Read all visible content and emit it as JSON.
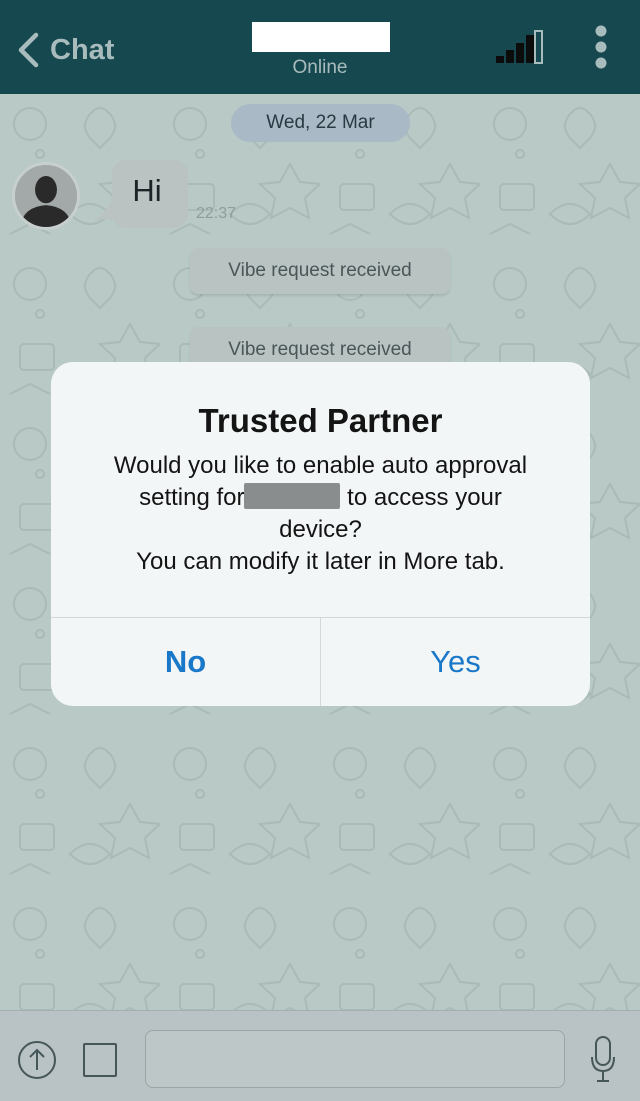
{
  "header": {
    "back_label": "Chat",
    "status": "Online"
  },
  "chat": {
    "date": "Wed, 22 Mar",
    "messages": [
      {
        "text": "Hi",
        "time": "22:37"
      }
    ],
    "system_messages": [
      "Vibe request received",
      "Vibe request received"
    ]
  },
  "alert": {
    "title": "Trusted Partner",
    "message_line1": "Would you like to enable auto approval",
    "message_line2_before": "setting for",
    "message_line2_after": "to access your",
    "message_line3": "device?",
    "message_line4": "You can modify it later in More tab.",
    "no_label": "No",
    "yes_label": "Yes"
  },
  "input_bar": {
    "placeholder": ""
  },
  "colors": {
    "header_bg": "#16484f",
    "header_text": "#a9bcbd",
    "chat_bg": "#b9c9c6",
    "alert_bg": "#f3f6f7",
    "button_blue": "#1a78c9"
  },
  "icons": {
    "back": "chevron-left-icon",
    "signal": "signal-bars-icon",
    "more": "more-vertical-icon",
    "upload": "upload-arrow-icon",
    "attach": "square-icon",
    "mic": "microphone-icon"
  }
}
